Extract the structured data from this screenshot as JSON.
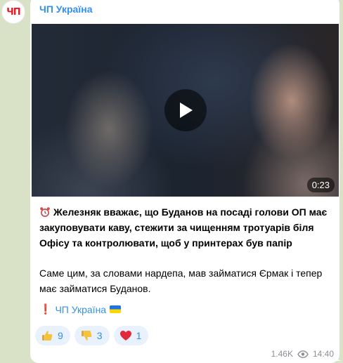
{
  "channel": {
    "name": "ЧП Україна",
    "avatar_text": "ЧП"
  },
  "video": {
    "duration": "0:23"
  },
  "post": {
    "paragraph_1": "Железняк вважає, що Буданов на посаді голови ОП має закуповувати каву, стежити за чищенням тротуарів біля Офісу та контролювати, щоб у принтерах був папір",
    "paragraph_2": "Саме цим, за словами нардепа, мав займатися Єрмак і тепер має займатися Буданов.",
    "signature": "ЧП Україна"
  },
  "reactions": [
    {
      "icon": "thumbs-up",
      "count": "9"
    },
    {
      "icon": "thumbs-down",
      "count": "3"
    },
    {
      "icon": "red-heart",
      "count": "1"
    }
  ],
  "meta": {
    "views": "1.46K",
    "time": "14:40"
  },
  "colors": {
    "accent": "#3390ec",
    "brand_red": "#e31b23",
    "background": "#d9e1c6"
  }
}
